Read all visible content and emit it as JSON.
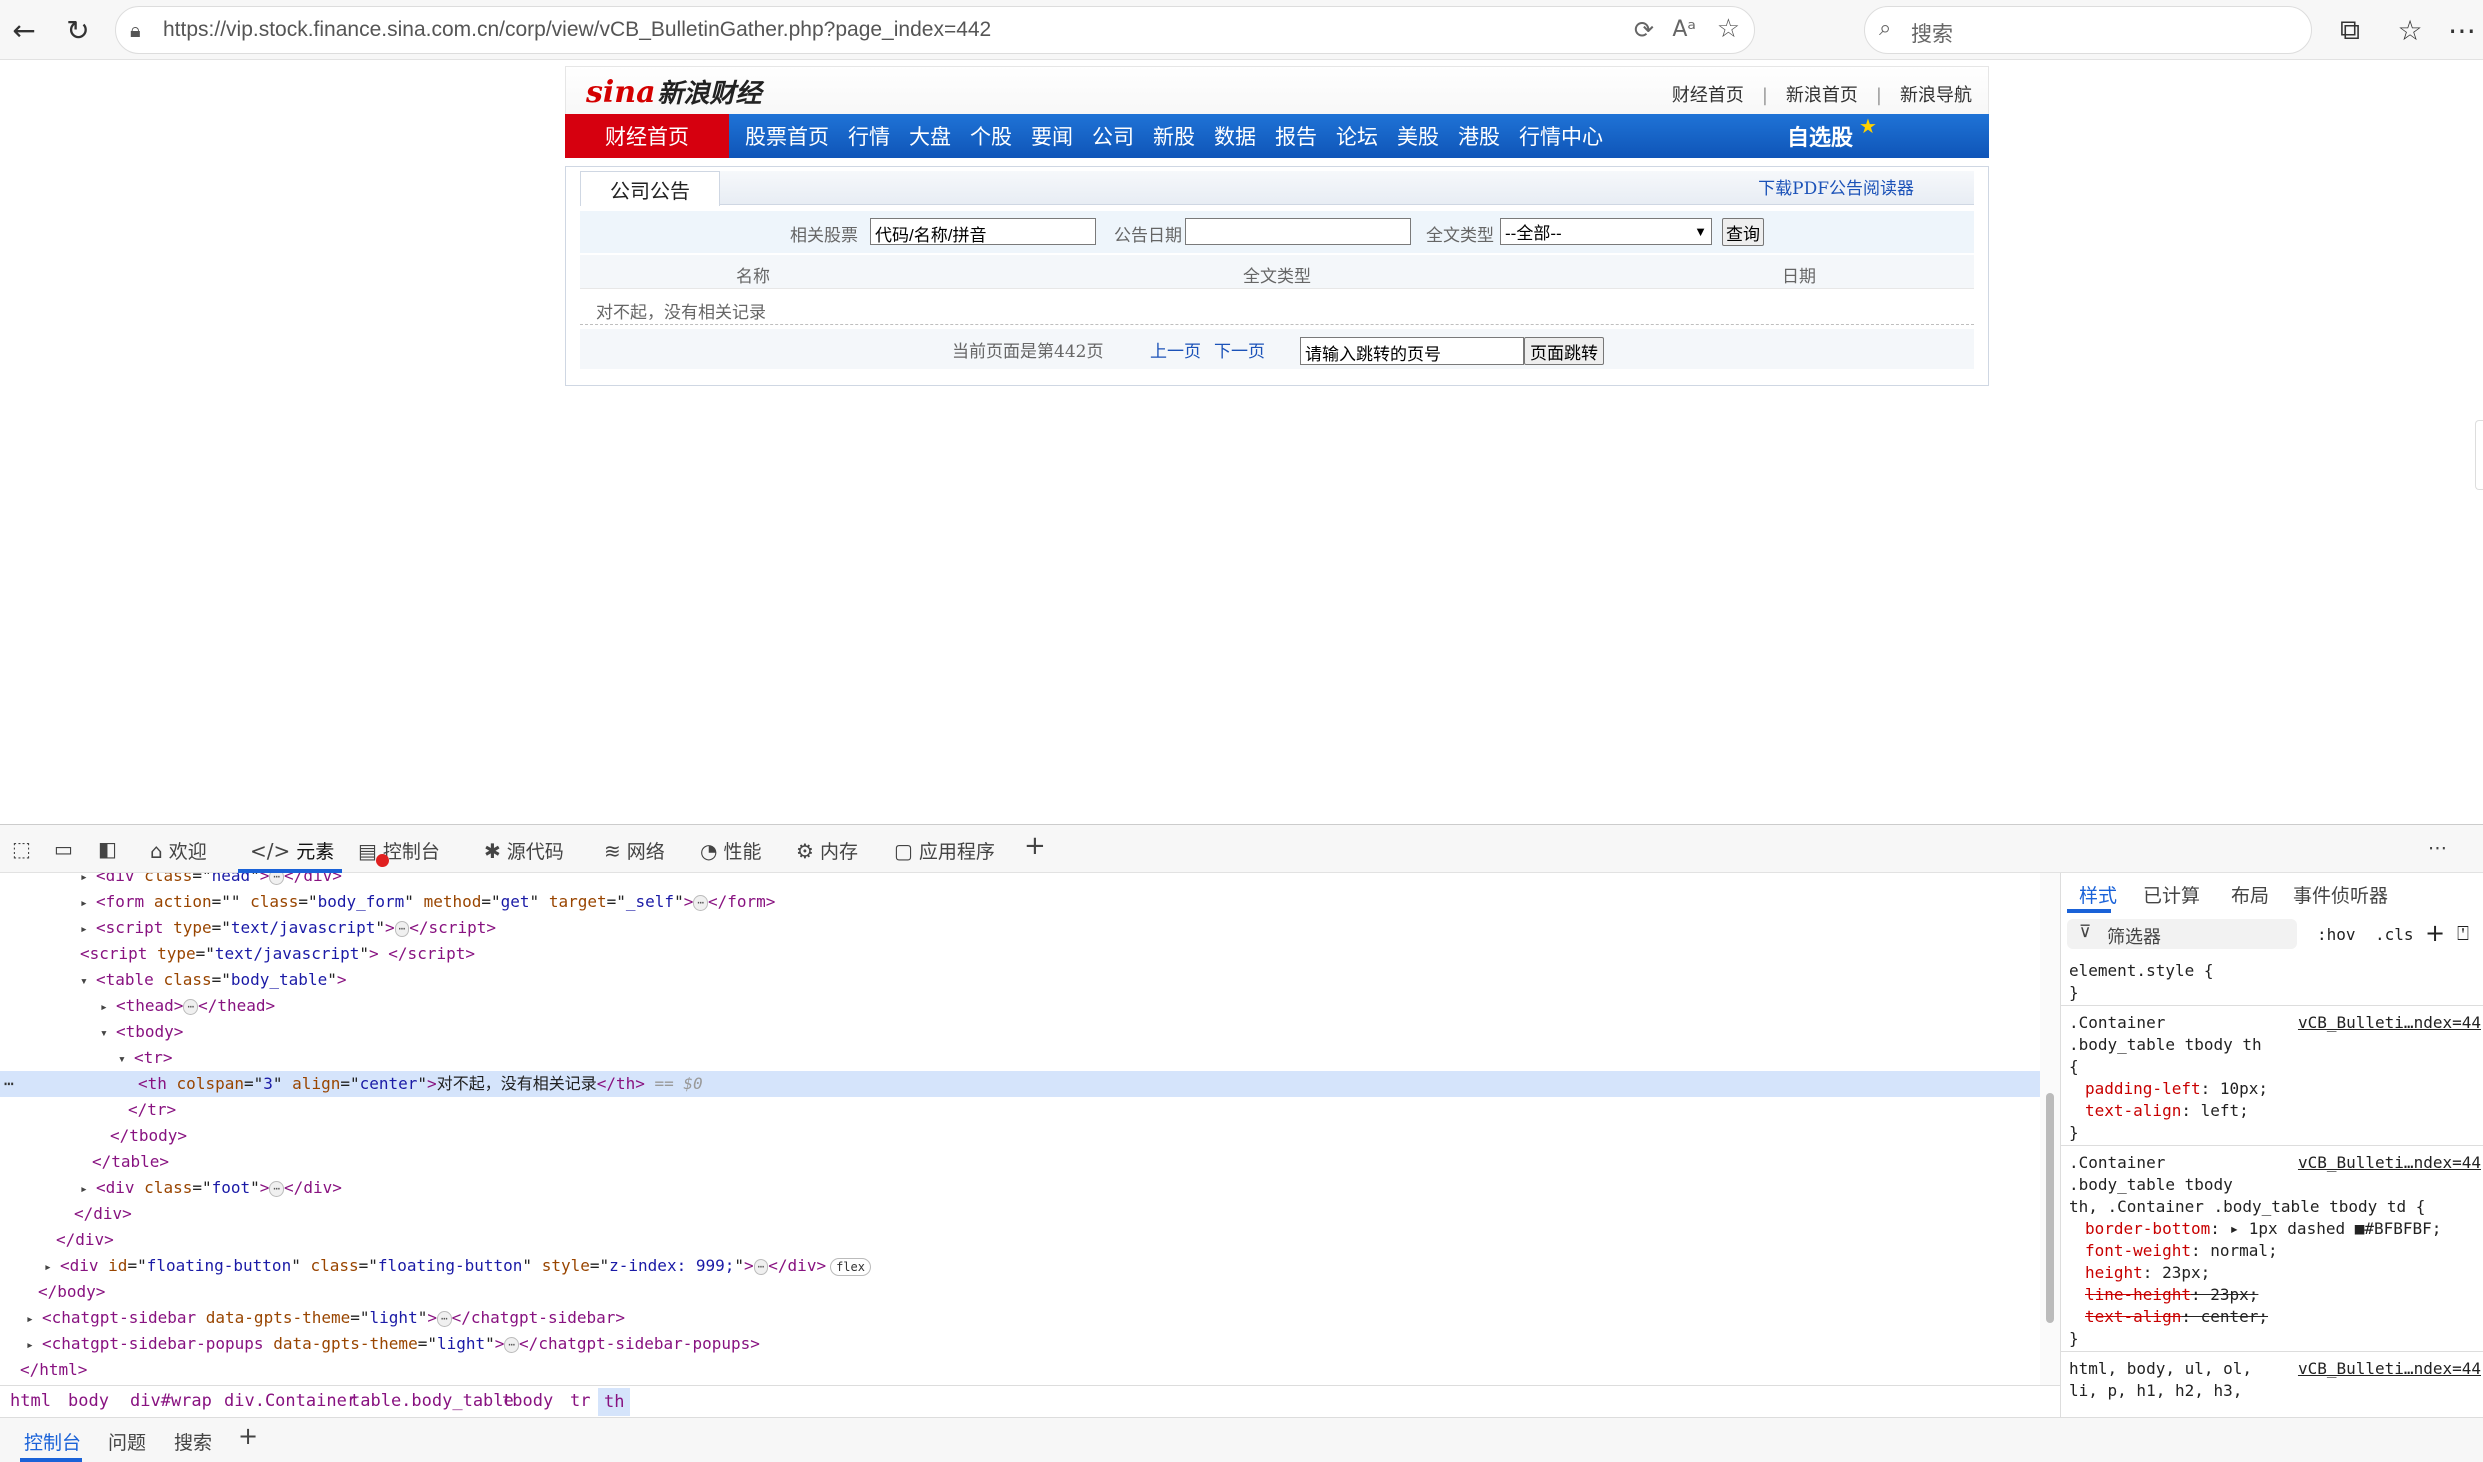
{
  "browser": {
    "url": "https://vip.stock.finance.sina.com.cn/corp/view/vCB_BulletinGather.php?page_index=442",
    "search_placeholder": "搜索"
  },
  "header": {
    "logo_sina": "sina",
    "logo_text": "新浪财经",
    "top_links": [
      "财经首页",
      "新浪首页",
      "新浪导航"
    ]
  },
  "nav": {
    "home": "财经首页",
    "items": [
      "股票首页",
      "行情",
      "大盘",
      "个股",
      "要闻",
      "公司",
      "新股",
      "数据",
      "报告",
      "论坛",
      "美股",
      "港股",
      "行情中心"
    ],
    "self_select": "自选股"
  },
  "notice": {
    "tab_label": "公司公告",
    "pdf_link": "下载PDF公告阅读器",
    "search": {
      "stock_label": "相关股票",
      "stock_value": "代码/名称/拼音",
      "date_label": "公告日期",
      "date_value": "",
      "type_label": "全文类型",
      "type_selected": "--全部--",
      "query_button": "查询"
    },
    "columns": [
      "名称",
      "全文类型",
      "日期"
    ],
    "empty_message": "对不起，没有相关记录",
    "pagination": {
      "current_text": "当前页面是第442页",
      "prev": "上一页",
      "next": "下一页",
      "jump_value": "请输入跳转的页号",
      "jump_button": "页面跳转"
    }
  },
  "devtools": {
    "tabs": [
      "欢迎",
      "元素",
      "控制台",
      "源代码",
      "网络",
      "性能",
      "内存",
      "应用程序"
    ],
    "dom_lines": [
      {
        "tag": "div",
        "attrs": [
          [
            "class",
            "head"
          ]
        ],
        "collapsed": true
      },
      {
        "tag": "form",
        "attrs": [
          [
            "action",
            ""
          ],
          [
            "class",
            "body_form"
          ],
          [
            "method",
            "get"
          ],
          [
            "target",
            "_self"
          ]
        ],
        "collapsed": true
      },
      {
        "tag": "script",
        "attrs": [
          [
            "type",
            "text/javascript"
          ]
        ],
        "collapsed": true
      },
      {
        "tag": "script",
        "attrs": [
          [
            "type",
            "text/javascript"
          ]
        ],
        "empty": true
      },
      {
        "tag": "table",
        "attrs": [
          [
            "class",
            "body_table"
          ]
        ],
        "open": true
      },
      {
        "tag": "thead",
        "attrs": [],
        "collapsed": true
      },
      {
        "tag": "tbody",
        "attrs": [],
        "open": true
      },
      {
        "tag": "tr",
        "attrs": [],
        "open": true
      },
      {
        "tag": "th",
        "attrs": [
          [
            "colspan",
            "3"
          ],
          [
            "align",
            "center"
          ]
        ],
        "text": "对不起，没有相关记录",
        "selected": true
      },
      {
        "close": "tr"
      },
      {
        "close": "tbody"
      },
      {
        "close": "table"
      },
      {
        "tag": "div",
        "attrs": [
          [
            "class",
            "foot"
          ]
        ],
        "collapsed": true
      },
      {
        "close": "div"
      },
      {
        "close": "div"
      },
      {
        "tag": "div",
        "attrs": [
          [
            "id",
            "floating-button"
          ],
          [
            "class",
            "floating-button"
          ],
          [
            "style",
            "z-index: 999;"
          ]
        ],
        "collapsed": true,
        "badge": "flex"
      },
      {
        "close": "body"
      },
      {
        "tag": "chatgpt-sidebar",
        "attrs": [
          [
            "data-gpts-theme",
            "light"
          ]
        ],
        "collapsed": true
      },
      {
        "tag": "chatgpt-sidebar-popups",
        "attrs": [
          [
            "data-gpts-theme",
            "light"
          ]
        ],
        "collapsed": true
      },
      {
        "close": "html"
      }
    ],
    "selected_suffix": "== $0",
    "breadcrumbs": [
      "html",
      "body",
      "div#wrap",
      "div.Container",
      "table.body_table",
      "tbody",
      "tr",
      "th"
    ],
    "drawer_tabs": [
      "控制台",
      "问题",
      "搜索"
    ],
    "styles_tabs": [
      "样式",
      "已计算",
      "布局",
      "事件侦听器"
    ],
    "filter_placeholder": "筛选器",
    "hov": ":hov",
    "cls": ".cls",
    "styles": {
      "element_style": "element.style {",
      "rule1_selector": [
        ".Container",
        ".body_table tbody th",
        "{"
      ],
      "rule1_source": "vCB_Bulleti…ndex=44",
      "rule1_props": [
        [
          "padding-left",
          "10px;"
        ],
        [
          "text-align",
          "left;"
        ]
      ],
      "rule2_selector": [
        ".Container",
        ".body_table tbody",
        "th, .Container .body_table tbody td {"
      ],
      "rule2_source": "vCB_Bulleti…ndex=44",
      "rule2_props": [
        [
          "border-bottom",
          "▸ 1px dashed ■#BFBFBF;"
        ],
        [
          "font-weight",
          "normal;"
        ],
        [
          "height",
          "23px;"
        ],
        [
          "line-height",
          "23px;"
        ],
        [
          "text-align",
          "center;"
        ]
      ],
      "rule3_selector": [
        "html, body, ul, ol,",
        "li, p, h1, h2, h3,"
      ],
      "rule3_source": "vCB_Bulleti…ndex=44"
    }
  }
}
